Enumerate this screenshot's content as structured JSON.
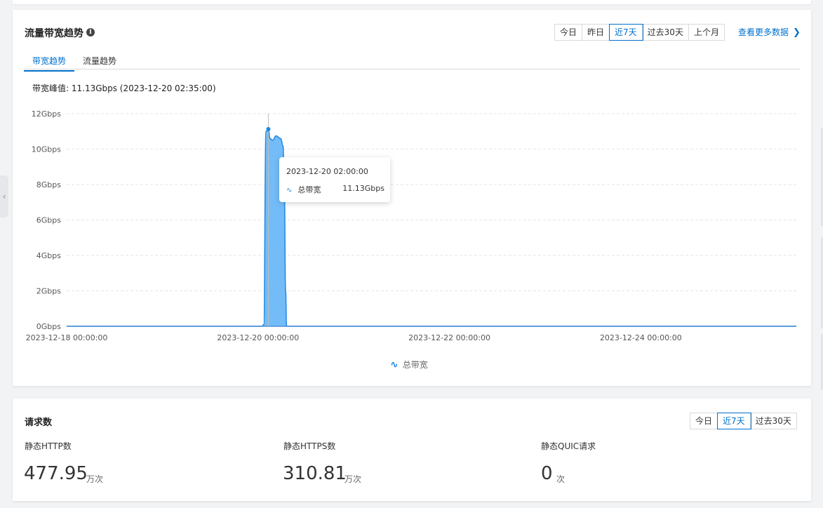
{
  "bandwidth_card": {
    "title": "流量带宽趋势",
    "info_icon": "info-circle-icon",
    "time_buttons": [
      "今日",
      "昨日",
      "近7天",
      "过去30天",
      "上个月"
    ],
    "active_time_button": "近7天",
    "more_link": "查看更多数据",
    "tabs": [
      "带宽趋势",
      "流量趋势"
    ],
    "active_tab": "带宽趋势",
    "peak_text": "带宽峰值: 11.13Gbps (2023-12-20 02:35:00)",
    "tooltip": {
      "time": "2023-12-20 02:00:00",
      "series": "总带宽",
      "value": "11.13Gbps"
    },
    "legend": "总带宽"
  },
  "chart_data": {
    "type": "area",
    "title": "",
    "xlabel": "",
    "ylabel": "",
    "y_ticks": [
      "12Gbps",
      "10Gbps",
      "8Gbps",
      "6Gbps",
      "4Gbps",
      "2Gbps",
      "0Gbps"
    ],
    "x_ticks": [
      "2023-12-18 00:00:00",
      "2023-12-20 00:00:00",
      "2023-12-22 00:00:00",
      "2023-12-24 00:00:00"
    ],
    "ylim": [
      0,
      12
    ],
    "xlim": [
      "2023-12-18 00:00:00",
      "2023-12-25 15:00:00"
    ],
    "grid": true,
    "legend_position": "bottom-center",
    "color": "#1e88e5",
    "fill_color": "#64b5f6",
    "series": [
      {
        "name": "总带宽",
        "x": [
          "2023-12-18 00:00:00",
          "2023-12-20 01:00:00",
          "2023-12-20 01:25:00",
          "2023-12-20 02:00:00",
          "2023-12-20 02:35:00",
          "2023-12-20 03:00:00",
          "2023-12-20 03:40:00",
          "2023-12-20 04:30:00",
          "2023-12-20 05:40:00",
          "2023-12-20 06:15:00",
          "2023-12-20 06:35:00",
          "2023-12-20 06:55:00",
          "2023-12-20 07:10:00",
          "2023-12-25 15:00:00"
        ],
        "y": [
          0,
          0,
          0.1,
          11.0,
          11.13,
          10.6,
          10.5,
          10.75,
          10.6,
          10.2,
          8,
          2,
          0,
          0
        ]
      }
    ],
    "marker": {
      "x": "2023-12-20 02:35:00",
      "y": 11.13
    }
  },
  "requests_card": {
    "title": "请求数",
    "time_buttons": [
      "今日",
      "近7天",
      "过去30天"
    ],
    "active_time_button": "近7天",
    "metrics": [
      {
        "label": "静态HTTP数",
        "value": "477.95",
        "unit": "万次"
      },
      {
        "label": "静态HTTPS数",
        "value": "310.81",
        "unit": "万次"
      },
      {
        "label": "静态QUIC请求",
        "value": "0",
        "unit": "次"
      }
    ]
  },
  "sidebar_handle_icon": "chevron-left-icon"
}
